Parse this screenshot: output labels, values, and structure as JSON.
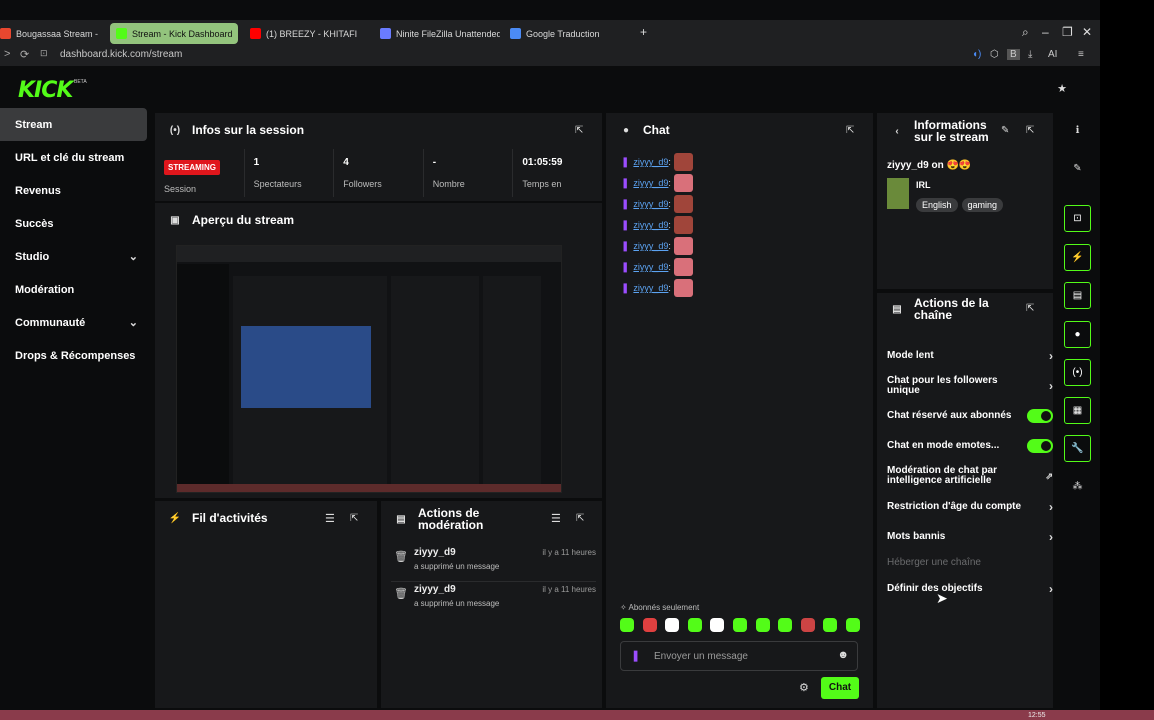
{
  "browser": {
    "tabs": [
      {
        "label": "Bougassaa Stream - Watc",
        "favicon_color": "#e8472f"
      },
      {
        "label": "Stream - Kick Dashboard",
        "favicon_color": "#53fc18"
      },
      {
        "label": "(1) BREEZY - KHITAFI",
        "favicon_color": "#ff0000"
      },
      {
        "label": "Ninite FileZilla Unattended",
        "favicon_color": "#6a7cff"
      },
      {
        "label": "Google Traduction",
        "favicon_color": "#4b8bf5"
      }
    ],
    "new_tab_icon": "+",
    "url": "dashboard.kick.com/stream",
    "ext_ai": "AI",
    "ext_b": "B"
  },
  "brand": {
    "logo": "KICK",
    "beta": "BETA",
    "accent": "#53fc18"
  },
  "sidebar": {
    "items": [
      {
        "label": "Stream",
        "chevron": false
      },
      {
        "label": "URL et clé du stream",
        "chevron": false
      },
      {
        "label": "Revenus",
        "chevron": false
      },
      {
        "label": "Succès",
        "chevron": false
      },
      {
        "label": "Studio",
        "chevron": true
      },
      {
        "label": "Modération",
        "chevron": false
      },
      {
        "label": "Communauté",
        "chevron": true
      },
      {
        "label": "Drops & Récompenses",
        "chevron": false
      }
    ]
  },
  "session": {
    "title": "Infos sur la session",
    "status_badge": "STREAMING",
    "stats": [
      {
        "value": "",
        "label": "Session"
      },
      {
        "value": "1",
        "label": "Spectateurs"
      },
      {
        "value": "4",
        "label": "Followers"
      },
      {
        "value": "-",
        "label": "Nombre"
      },
      {
        "value": "01:05:59",
        "label": "Temps en"
      }
    ]
  },
  "preview": {
    "title": "Aperçu du stream"
  },
  "activity": {
    "title": "Fil d'activités"
  },
  "modactions": {
    "title_line1": "Actions de",
    "title_line2": "modération",
    "items": [
      {
        "user": "ziyyy_d9",
        "desc": "a supprimé un message",
        "time": "il y a 11 heures"
      },
      {
        "user": "ziyyy_d9",
        "desc": "a supprimé un message",
        "time": "il y a 11 heures"
      }
    ]
  },
  "chat": {
    "title": "Chat",
    "messages": [
      {
        "user": "ziyyy_d9",
        "emote_color": "#a0453a"
      },
      {
        "user": "ziyyy_d9",
        "emote_color": "#d9707a"
      },
      {
        "user": "ziyyy_d9",
        "emote_color": "#a0453a"
      },
      {
        "user": "ziyyy_d9",
        "emote_color": "#a0453a"
      },
      {
        "user": "ziyyy_d9",
        "emote_color": "#d9707a"
      },
      {
        "user": "ziyyy_d9",
        "emote_color": "#d9707a"
      },
      {
        "user": "ziyyy_d9",
        "emote_color": "#d9707a"
      }
    ],
    "colon": ":",
    "subscribers_only": "Abonnés seulement",
    "placeholder": "Envoyer un message",
    "send_label": "Chat"
  },
  "stream_info": {
    "title_line1": "Informations",
    "title_line2": "sur le stream",
    "owner_line": "ziyyy_d9 on 😍😍",
    "category": "IRL",
    "tags": [
      "English",
      "gaming"
    ]
  },
  "channel_actions": {
    "title_line1": "Actions de la",
    "title_line2": "chaîne",
    "items": [
      {
        "label": "Mode lent",
        "control": "arrow"
      },
      {
        "label": "Chat pour les followers unique",
        "control": "arrow"
      },
      {
        "label": "Chat réservé aux abonnés",
        "control": "toggle-on"
      },
      {
        "label": "Chat en mode emotes...",
        "control": "toggle-on"
      },
      {
        "label": "Modération de chat par intelligence artificielle",
        "control": "external"
      },
      {
        "label": "Restriction d'âge du compte",
        "control": "arrow"
      },
      {
        "label": "Mots bannis",
        "control": "arrow"
      },
      {
        "label": "Héberger une chaîne",
        "control": "disabled"
      },
      {
        "label": "Définir des objectifs",
        "control": "arrow"
      }
    ]
  },
  "right_rail": [
    "info-icon",
    "pencil-icon",
    "focus-icon",
    "bolt-icon",
    "document-icon",
    "chat-bubble-icon",
    "broadcast-icon",
    "layout-icon",
    "wrench-icon",
    "people-icon"
  ],
  "taskbar": {
    "time": "12:55"
  }
}
